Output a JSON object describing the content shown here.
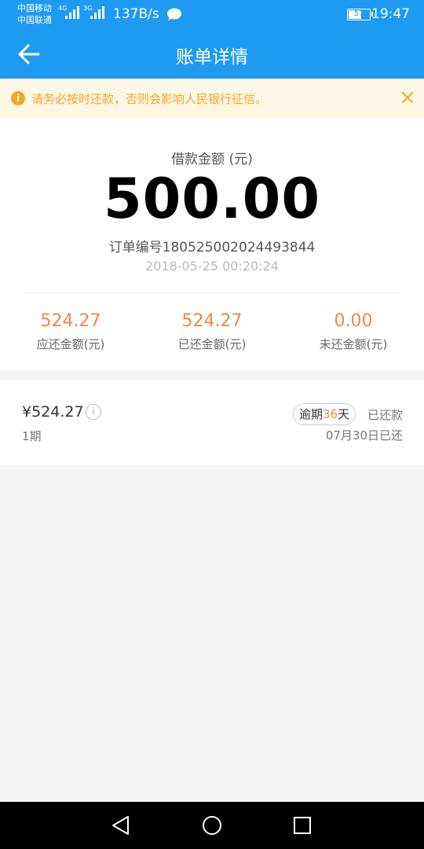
{
  "status_bar": {
    "carrier1": "中国移动",
    "carrier2": "中国联通",
    "sim1_network": "4G",
    "sim2_network": "3G",
    "net_speed": "137B/s",
    "battery": "57",
    "time": "19:47"
  },
  "header": {
    "title": "账单详情",
    "back_icon": "arrow-left-icon"
  },
  "notice": {
    "icon_text": "i",
    "text": "请务必按时还款，否则会影响人民银行征信。",
    "color": "#f5a623"
  },
  "summary": {
    "loan_label": "借款金额 (元)",
    "loan_amount": "500.00",
    "order_no": "订单编号180525002024493844",
    "order_time": "2018-05-25 00:20:24",
    "stats": [
      {
        "value": "524.27",
        "label": "应还金额(元)"
      },
      {
        "value": "524.27",
        "label": "已还金额(元)"
      },
      {
        "value": "0.00",
        "label": "未还金额(元)"
      }
    ]
  },
  "installment": {
    "amount": "¥524.27",
    "info_icon_text": "i",
    "period": "1期",
    "overdue_prefix": "逾期",
    "overdue_days": "36",
    "overdue_suffix": "天",
    "status": "已还款",
    "paid_date": "07月30日已还"
  },
  "colors": {
    "primary": "#1e9bf0",
    "accent": "#f0864a",
    "notice": "#f5a623"
  }
}
